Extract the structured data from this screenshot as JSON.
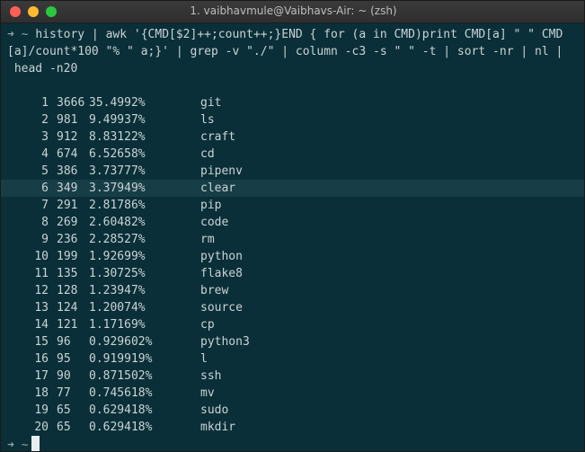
{
  "window": {
    "title": "1. vaibhavmule@Vaibhavs-Air: ~ (zsh)",
    "colors": {
      "close": "#ff5f57",
      "minimize": "#febc2e",
      "maximize": "#28c840",
      "background": "#0a2f38",
      "highlight_row": "#173e47",
      "text": "#c9d3d6"
    }
  },
  "prompt": {
    "arrow": "➜",
    "dir": "~"
  },
  "command": {
    "lines": [
      "history | awk '{CMD[$2]++;count++;}END { for (a in CMD)print CMD[a] \" \" CMD",
      "[a]/count*100 \"% \" a;}' | grep -v \"./\" | column -c3 -s \" \" -t | sort -nr | nl |",
      " head -n20"
    ]
  },
  "output": {
    "highlight_index": 5,
    "rows": [
      {
        "n": "1",
        "count": "3666",
        "pct": "35.4992%",
        "cmd": "git"
      },
      {
        "n": "2",
        "count": "981",
        "pct": "9.49937%",
        "cmd": "ls"
      },
      {
        "n": "3",
        "count": "912",
        "pct": "8.83122%",
        "cmd": "craft"
      },
      {
        "n": "4",
        "count": "674",
        "pct": "6.52658%",
        "cmd": "cd"
      },
      {
        "n": "5",
        "count": "386",
        "pct": "3.73777%",
        "cmd": "pipenv"
      },
      {
        "n": "6",
        "count": "349",
        "pct": "3.37949%",
        "cmd": "clear"
      },
      {
        "n": "7",
        "count": "291",
        "pct": "2.81786%",
        "cmd": "pip"
      },
      {
        "n": "8",
        "count": "269",
        "pct": "2.60482%",
        "cmd": "code"
      },
      {
        "n": "9",
        "count": "236",
        "pct": "2.28527%",
        "cmd": "rm"
      },
      {
        "n": "10",
        "count": "199",
        "pct": "1.92699%",
        "cmd": "python"
      },
      {
        "n": "11",
        "count": "135",
        "pct": "1.30725%",
        "cmd": "flake8"
      },
      {
        "n": "12",
        "count": "128",
        "pct": "1.23947%",
        "cmd": "brew"
      },
      {
        "n": "13",
        "count": "124",
        "pct": "1.20074%",
        "cmd": "source"
      },
      {
        "n": "14",
        "count": "121",
        "pct": "1.17169%",
        "cmd": "cp"
      },
      {
        "n": "15",
        "count": "96",
        "pct": "0.929602%",
        "cmd": "python3"
      },
      {
        "n": "16",
        "count": "95",
        "pct": "0.919919%",
        "cmd": "l"
      },
      {
        "n": "17",
        "count": "90",
        "pct": "0.871502%",
        "cmd": "ssh"
      },
      {
        "n": "18",
        "count": "77",
        "pct": "0.745618%",
        "cmd": "mv"
      },
      {
        "n": "19",
        "count": "65",
        "pct": "0.629418%",
        "cmd": "sudo"
      },
      {
        "n": "20",
        "count": "65",
        "pct": "0.629418%",
        "cmd": "mkdir"
      }
    ]
  }
}
